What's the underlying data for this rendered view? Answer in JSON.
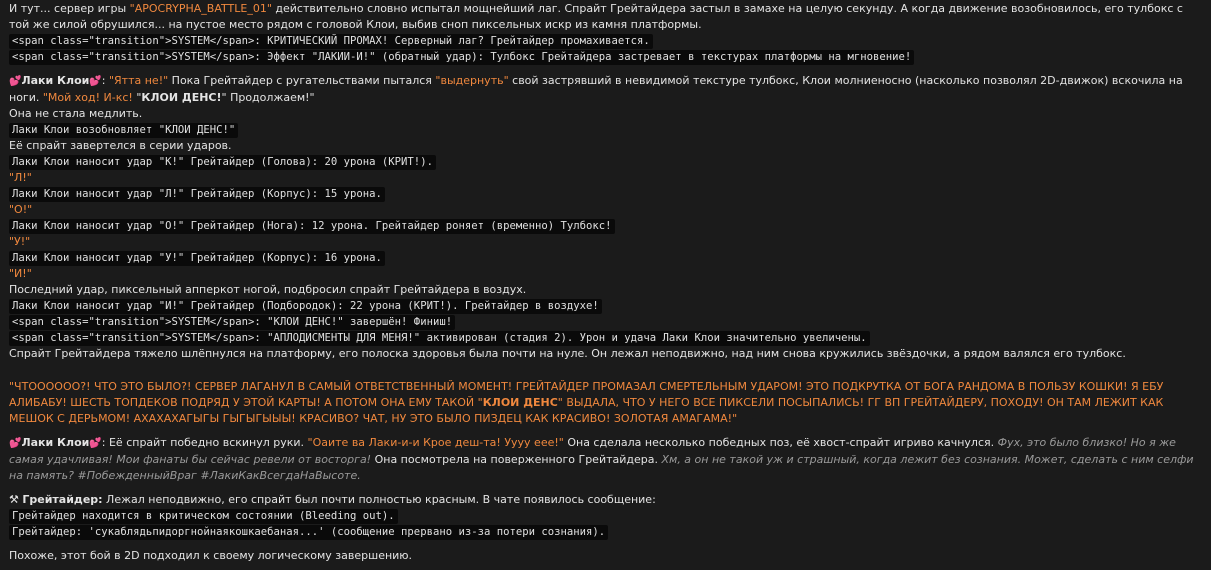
{
  "intro": {
    "pre": "И тут... сервер игры ",
    "server": "\"APOCRYPHA_BATTLE_01\"",
    "post": " действительно словно испытал мощнейший лаг. Спрайт Грейтайдера застыл в замахе на целую секунду. А когда движение возобновилось, его тулбокс с той же силой обрушился... на пустое место рядом с головой Клои, выбив сноп пиксельных искр из камня платформы."
  },
  "codes1": [
    "<span class=\"transition\">SYSTEM</span>: КРИТИЧЕСКИЙ ПРОМАХ! Серверный лаг? Грейтайдер промахивается.",
    "<span class=\"transition\">SYSTEM</span>: Эффект \"ЛАКИИ-И!\" (обратный удар): Тулбокс Грейтайдера застревает в текстурах платформы на мгновение!"
  ],
  "chloe1": {
    "heart": "💕",
    "name": "Лаки Клои",
    "heart2": "💕",
    "colon": ": ",
    "q1": "\"Ятта не!\"",
    "t1": " Пока Грейтайдер с ругательствами пытался ",
    "q2": "\"выдернуть\"",
    "t2": " свой застрявший в невидимой текстуре тулбокс, Клои молниеносно (насколько позволял 2D-движок) вскочила на ноги. ",
    "q3": "\"Мой ход! И-кс!",
    "q3b": "\"",
    "q3bold": "КЛОИ ДЕНС!",
    "q3c": "\" Продолжаем!\"",
    "after": "Она не стала медлить."
  },
  "seq": [
    {
      "code": "Лаки Клои возобновляет \"КЛОИ ДЕНС!\"",
      "text": "Её спрайт завертелся в серии ударов.",
      "textClass": ""
    },
    {
      "code": "Лаки Клои наносит удар \"К!\" Грейтайдер (Голова): 20 урона (КРИТ!).",
      "text": "\"Л!\"",
      "textClass": "orange"
    },
    {
      "code": "Лаки Клои наносит удар \"Л!\" Грейтайдер (Корпус): 15 урона.",
      "text": "\"О!\"",
      "textClass": "orange"
    },
    {
      "code": "Лаки Клои наносит удар \"О!\" Грейтайдер (Нога): 12 урона. Грейтайдер роняет (временно) Тулбокс!",
      "text": "\"У!\"",
      "textClass": "orange"
    },
    {
      "code": "Лаки Клои наносит удар \"У!\" Грейтайдер (Корпус): 16 урона.",
      "text": "\"И!\"",
      "textClass": "orange"
    }
  ],
  "uppercut": "Последний удар, пиксельный апперкот ногой, подбросил спрайт Грейтайдера в воздух.",
  "codes2": [
    "Лаки Клои наносит удар \"И!\" Грейтайдер (Подбородок): 22 урона (КРИТ!). Грейтайдер в воздухе!",
    "<span class=\"transition\">SYSTEM</span>: \"КЛОИ ДЕНС!\" завершён! Финиш!",
    "<span class=\"transition\">SYSTEM</span>: \"АПЛОДИСМЕНТЫ ДЛЯ МЕНЯ!\" активирован (стадия 2). Урон и удача Лаки Клои значительно увеличены."
  ],
  "fall": "Спрайт Грейтайдера тяжело шлёпнулся на платформу, его полоска здоровья была почти на нуле. Он лежал неподвижно, над ним снова кружились звёздочки, а рядом валялся его тулбокс.",
  "shout": {
    "a": "\"ЧТОООООО?! ЧТО ЭТО БЫЛО?! СЕРВЕР ЛАГАНУЛ В САМЫЙ ОТВЕТСТВЕННЫЙ МОМЕНТ! ГРЕЙТАЙДЕР ПРОМАЗАЛ СМЕРТЕЛЬНЫМ УДАРОМ! ЭТО ПОДКРУТКА ОТ БОГА РАНДОМА В ПОЛЬЗУ КОШКИ! Я ЕБУ АЛИБАБУ! ШЕСТЬ ТОПДЕКОВ ПОДРЯД У ЭТОЙ КАРТЫ! А ПОТОМ ОНА ЕМУ ТАКОЙ \"",
    "bold": "КЛОИ ДЕНС",
    "b": "\" ВЫДАЛА, ЧТО У НЕГО ВСЕ ПИКСЕЛИ ПОСЫПАЛИСЬ! ГГ ВП ГРЕЙТАЙДЕРУ, ПОХОДУ! ОН ТАМ ЛЕЖИТ КАК МЕШОК С ДЕРЬМОМ! АХАХАХАГЫГЫ ГЫГЫГЫЫЫ! КРАСИВО? ЧАТ, НУ ЭТО БЫЛО ПИЗДЕЦ КАК КРАСИВО! ЗОЛОТАЯ АМАГАМА!\""
  },
  "chloe2": {
    "heart": "💕",
    "name": "Лаки Клои",
    "heart2": "💕",
    "t1": ": Её спрайт победно вскинул руки. ",
    "q1": "\"Оаите ва Лаки-и-и Крое деш-та! Уууу еее!\"",
    "t2": " Она сделала несколько победных поз, её хвост-спрайт игриво качнулся. ",
    "i1": "Фух, это было близко! Но я же самая удачливая! Мои фанаты бы сейчас ревели от восторга!",
    "t3": " Она посмотрела на поверженного Грейтайдера. ",
    "i2": "Хм, а он не такой уж и страшный, когда лежит без сознания. Может, сделать с ним селфи на память? #ПобежденныйВраг #ЛакиКакВсегдаНаВысоте."
  },
  "grey": {
    "icon": "⚒",
    "name": "Грейтайдер:",
    "t1": " Лежал неподвижно, его спрайт был почти полностью красным. В чате появилось сообщение:",
    "codes": [
      "Грейтайдер находится в критическом состоянии (Bleeding out).",
      "Грейтайдер: 'сукаблядьпидоргнойнаякошкаебаная...' (сообщение прервано из-за потери сознания)."
    ]
  },
  "ending": "Похоже, этот бой в 2D подходил к своему логическому завершению."
}
